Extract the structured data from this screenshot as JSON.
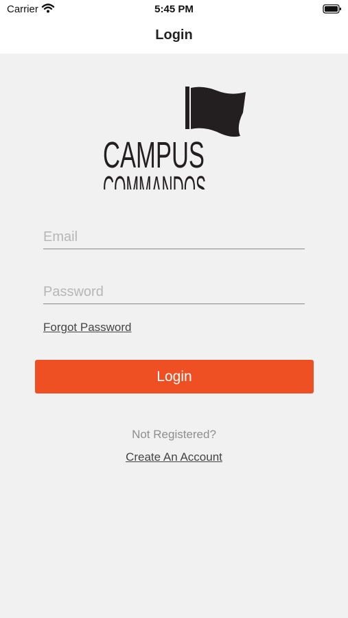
{
  "status_bar": {
    "carrier": "Carrier",
    "time": "5:45 PM",
    "wifi_icon": "wifi-icon",
    "battery_icon": "battery-icon"
  },
  "nav": {
    "title": "Login"
  },
  "logo": {
    "line1": "CAMPUS",
    "line2": "COMMANDOS",
    "icon": "flag-icon"
  },
  "form": {
    "email_placeholder": "Email",
    "email_value": "",
    "password_placeholder": "Password",
    "password_value": "",
    "forgot_label": "Forgot Password",
    "login_label": "Login"
  },
  "footer": {
    "prompt": "Not Registered?",
    "create_label": "Create An Account"
  },
  "colors": {
    "accent": "#ef5023",
    "background": "#f1f1f2",
    "header": "#ffffff"
  }
}
